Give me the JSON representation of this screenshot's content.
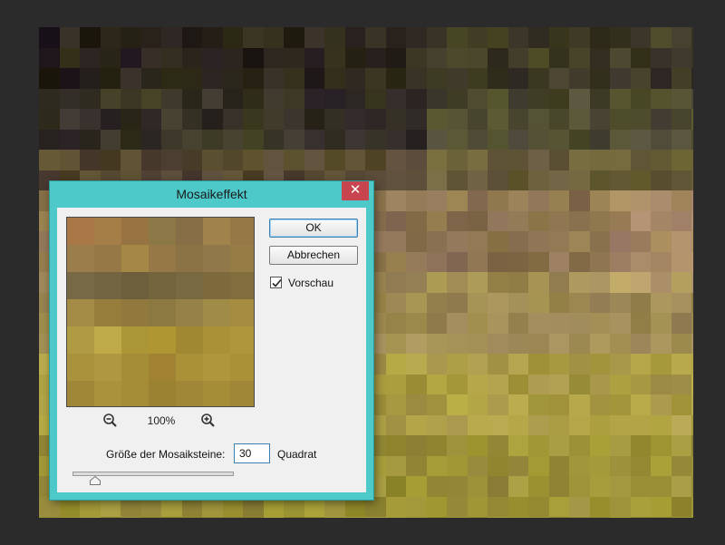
{
  "dialog": {
    "title": "Mosaikeffekt",
    "close_glyph": "✕",
    "ok_label": "OK",
    "cancel_label": "Abbrechen",
    "preview_checkbox": {
      "label": "Vorschau",
      "checked": true
    },
    "zoom": {
      "level": "100%",
      "zoom_out_icon": "zoom-out-icon",
      "zoom_in_icon": "zoom-in-icon"
    },
    "cell_size": {
      "label": "Größe der Mosaiksteine:",
      "value": "30",
      "unit": "Quadrat"
    }
  },
  "colors": {
    "dialog_frame": "#4ec9c9",
    "close_button": "#c8444f",
    "dialog_body": "#f0f0f0",
    "app_background": "#2b2b2b"
  }
}
